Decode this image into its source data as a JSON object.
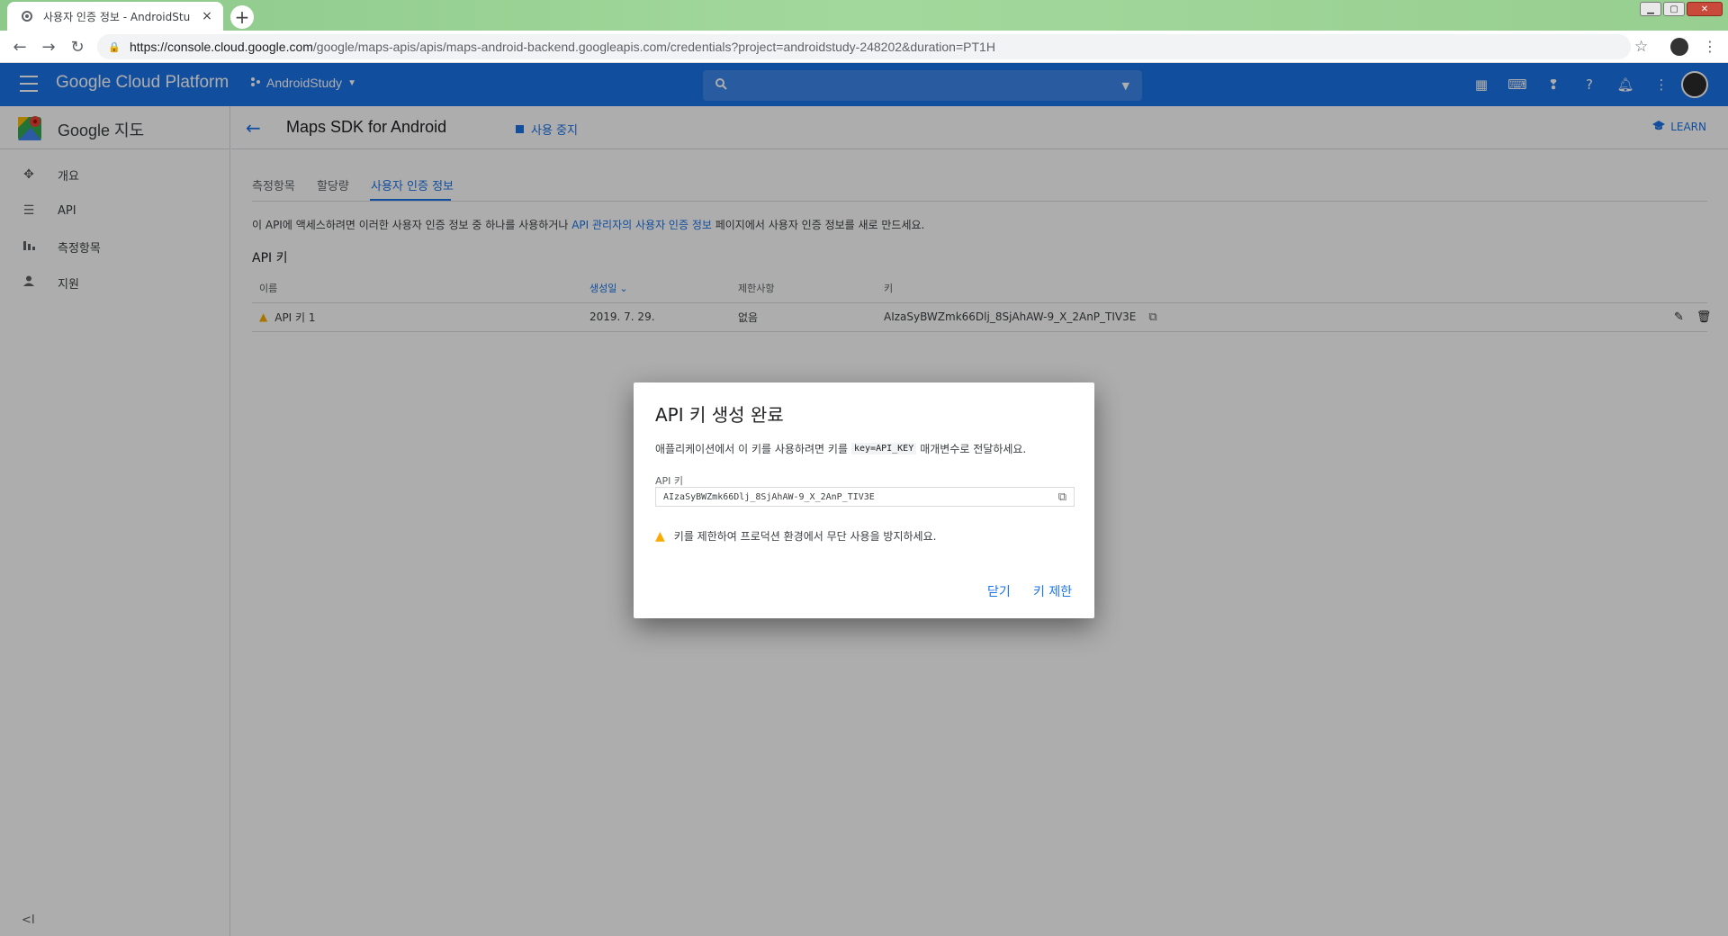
{
  "browser": {
    "tab_title": "사용자 인증 정보 - AndroidStud",
    "tab_close": "×",
    "new_tab": "+",
    "url_host": "https://console.cloud.google.com",
    "url_rest": "/google/maps-apis/apis/maps-android-backend.googleapis.com/credentials?project=androidstudy-248202&duration=PT1H"
  },
  "header": {
    "title": "Google Cloud Platform",
    "project": "AndroidStudy"
  },
  "sidebar": {
    "title": "Google 지도",
    "items": [
      {
        "label": "개요",
        "icon": "overview-icon"
      },
      {
        "label": "API",
        "icon": "list-icon"
      },
      {
        "label": "측정항목",
        "icon": "bar-chart-icon"
      },
      {
        "label": "지원",
        "icon": "person-icon"
      }
    ]
  },
  "page": {
    "title": "Maps SDK for Android",
    "disable_label": "사용 중지",
    "learn_label": "LEARN",
    "tabs": [
      "측정항목",
      "할당량",
      "사용자 인증 정보"
    ],
    "active_tab": 2,
    "info_prefix": "이 API에 액세스하려면 이러한 사용자 인증 정보 중 하나를 사용하거나 ",
    "info_link": "API 관리자의 사용자 인증 정보",
    "info_suffix": " 페이지에서 사용자 인증 정보를 새로 만드세요.",
    "section_title": "API 키"
  },
  "table": {
    "headers": [
      "이름",
      "생성일",
      "제한사항",
      "키"
    ],
    "sort_indicator": "⌄",
    "rows": [
      {
        "name": "API 키 1",
        "created": "2019. 7. 29.",
        "restriction": "없음",
        "key": "AIzaSyBWZmk66Dlj_8SjAhAW-9_X_2AnP_TIV3E"
      }
    ]
  },
  "dialog": {
    "title": "API 키 생성 완료",
    "desc_prefix": "애플리케이션에서 이 키를 사용하려면 키를",
    "desc_code": "key=API_KEY",
    "desc_suffix": "매개변수로 전달하세요.",
    "field_label": "API 키",
    "field_value": "AIzaSyBWZmk66Dlj_8SjAhAW-9_X_2AnP_TIV3E",
    "warning": "키를 제한하여 프로덕션 환경에서 무단 사용을 방지하세요.",
    "close_label": "닫기",
    "restrict_label": "키 제한"
  },
  "colors": {
    "accent": "#1a73e8",
    "warning": "#f9ab00"
  }
}
